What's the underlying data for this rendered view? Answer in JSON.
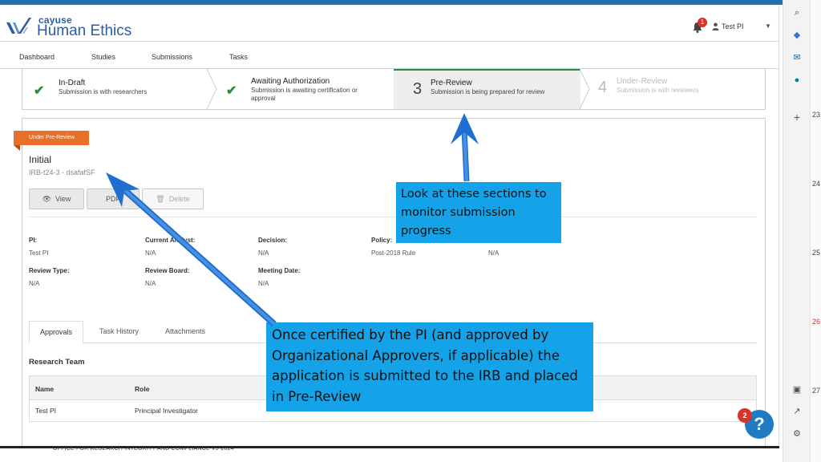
{
  "header": {
    "logo_small": "cayuse",
    "logo_big": "Human Ethics",
    "notification_count": "1",
    "user_name": "Test PI"
  },
  "nav": {
    "items": [
      "Dashboard",
      "Studies",
      "Submissions",
      "Tasks"
    ]
  },
  "stepper": {
    "steps": [
      {
        "title": "In-Draft",
        "desc": "Submission is with researchers",
        "state": "complete",
        "num": ""
      },
      {
        "title": "Awaiting Authorization",
        "desc": "Submission is awaiting certification or approval",
        "state": "complete",
        "num": ""
      },
      {
        "title": "Pre-Review",
        "desc": "Submission is being prepared for review",
        "state": "current",
        "num": "3"
      },
      {
        "title": "Under-Review",
        "desc": "Submission is with reviewers",
        "state": "future",
        "num": "4"
      }
    ]
  },
  "submission": {
    "status_ribbon": "Under Pre-Review",
    "title": "Initial",
    "id": "IRB-t24-3 - dsafafSF",
    "buttons": {
      "view": "View",
      "pdf": "PDF",
      "delete": "Delete"
    }
  },
  "fields": {
    "pi_label": "PI:",
    "pi_value": "Test PI",
    "analyst_label": "Current Analyst:",
    "analyst_value": "N/A",
    "decision_label": "Decision:",
    "decision_value": "N/A",
    "policy_label": "Policy:",
    "policy_value": "Post-2018 Rule",
    "extra_value": "N/A",
    "review_type_label": "Review Type:",
    "review_type_value": "N/A",
    "review_board_label": "Review Board:",
    "review_board_value": "N/A",
    "meeting_date_label": "Meeting Date:",
    "meeting_date_value": "N/A"
  },
  "tabs": [
    "Approvals",
    "Task History",
    "Attachments"
  ],
  "research_team": {
    "title": "Research Team",
    "columns": [
      "Name",
      "Role"
    ],
    "rows": [
      [
        "Test PI",
        "Principal Investigator"
      ]
    ]
  },
  "help": {
    "label": "?",
    "badge": "2"
  },
  "callouts": {
    "monitor": "Look at these sections to monitor submission progress",
    "certified": "Once certified by the PI (and approved by Organizational Approvers, if applicable) the application is submitted to the IRB and placed in Pre-Review"
  },
  "footer": {
    "text": "OFFICE FOR RESEARCH INTEGRITY AND COMPLIANCE V5-2024"
  },
  "right_pane": {
    "numbers": [
      "23",
      "24",
      "25",
      "26",
      "27"
    ]
  },
  "colors": {
    "brand": "#2d5da1",
    "accent": "#e8702a",
    "callout": "#14a3e8",
    "arrow": "#1e6fd1",
    "check": "#2e8b3a"
  }
}
